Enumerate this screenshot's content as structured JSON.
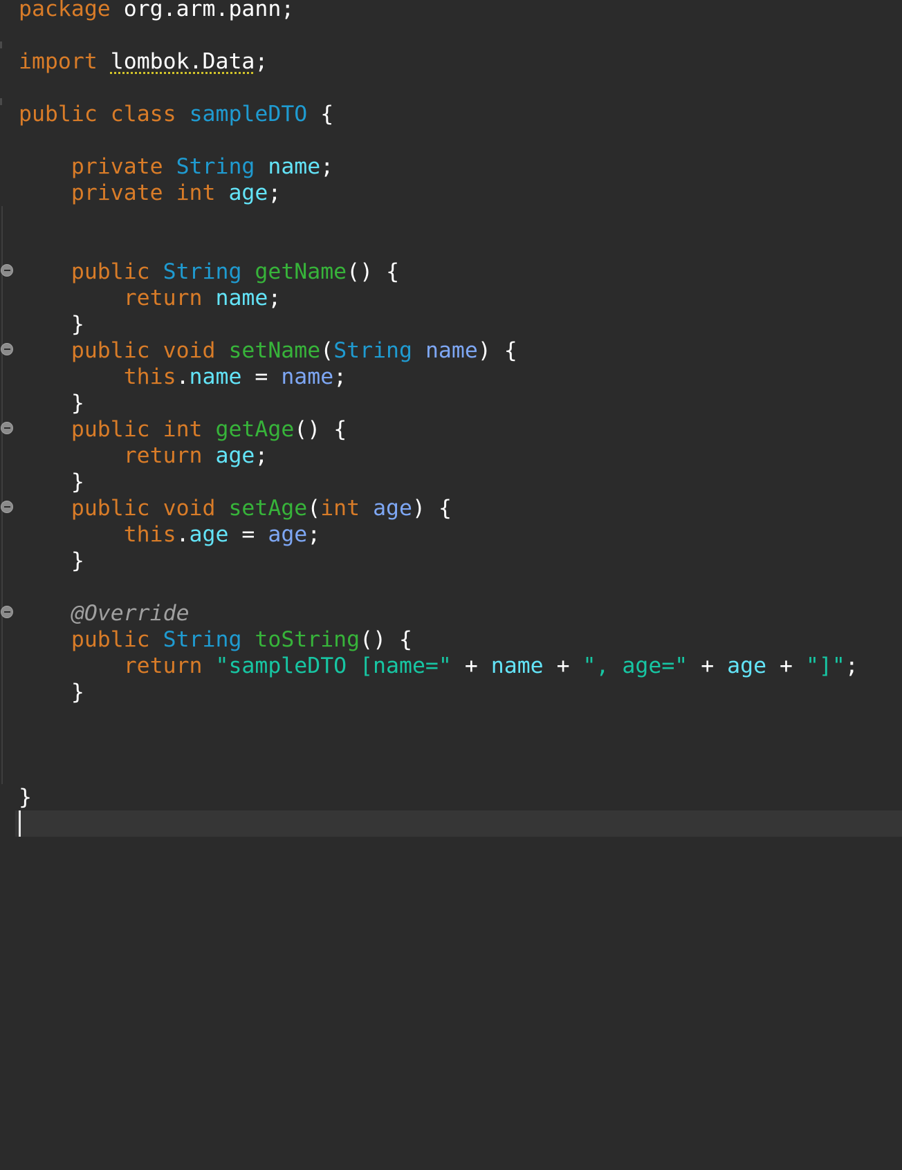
{
  "colors": {
    "background": "#2b2b2b",
    "current_line": "#363636",
    "keyword": "#d97c28",
    "type": "#1f9bd1",
    "method": "#37b43a",
    "field": "#63e4f8",
    "parameter": "#7ea7f4",
    "string": "#17c6a3",
    "annotation": "#a0a0a0",
    "punctuation": "#ffffff",
    "warning_underline": "#d3c52a"
  },
  "gutter": {
    "fold_marker_icon": "collapse-circle-icon"
  },
  "code": {
    "l1": {
      "kw": "package",
      "pkg": "org.arm.pann;"
    },
    "l2": {
      "kw": "import",
      "target": "lombok.Data",
      "end": ";"
    },
    "l3": {
      "kw1": "public",
      "kw2": "class",
      "cls": "sampleDTO",
      "brace": "{"
    },
    "l4": {
      "kw": "private",
      "type": "String",
      "field": "name",
      "end": ";"
    },
    "l5": {
      "kw": "private",
      "type": "int",
      "field": "age",
      "end": ";"
    },
    "l6": {
      "kw": "public",
      "type": "String",
      "method": "getName",
      "parens": "()",
      "brace": "{"
    },
    "l7": {
      "kw": "return",
      "field": "name",
      "end": ";"
    },
    "l8": {
      "brace": "}"
    },
    "l9": {
      "kw1": "public",
      "kw2": "void",
      "method": "setName",
      "open": "(",
      "ptype": "String",
      "param": "name",
      "close": ")",
      "brace": "{"
    },
    "l10": {
      "kw": "this",
      "dot": ".",
      "field": "name",
      "eq": "=",
      "param": "name",
      "end": ";"
    },
    "l11": {
      "brace": "}"
    },
    "l12": {
      "kw1": "public",
      "kw2": "int",
      "method": "getAge",
      "parens": "()",
      "brace": "{"
    },
    "l13": {
      "kw": "return",
      "field": "age",
      "end": ";"
    },
    "l14": {
      "brace": "}"
    },
    "l15": {
      "kw1": "public",
      "kw2": "void",
      "method": "setAge",
      "open": "(",
      "ptype": "int",
      "param": "age",
      "close": ")",
      "brace": "{"
    },
    "l16": {
      "kw": "this",
      "dot": ".",
      "field": "age",
      "eq": "=",
      "param": "age",
      "end": ";"
    },
    "l17": {
      "brace": "}"
    },
    "l18": {
      "annotation": "@Override"
    },
    "l19": {
      "kw": "public",
      "type": "String",
      "method": "toString",
      "parens": "()",
      "brace": "{"
    },
    "l20": {
      "kw": "return",
      "s1": "\"sampleDTO [name=\"",
      "plus1": "+",
      "f1": "name",
      "plus2": "+",
      "s2": "\", age=\"",
      "plus3": "+",
      "f2": "age",
      "plus4": "+",
      "s3": "\"]\"",
      "end": ";"
    },
    "l21": {
      "brace": "}"
    },
    "l22": {
      "brace": "}"
    }
  }
}
